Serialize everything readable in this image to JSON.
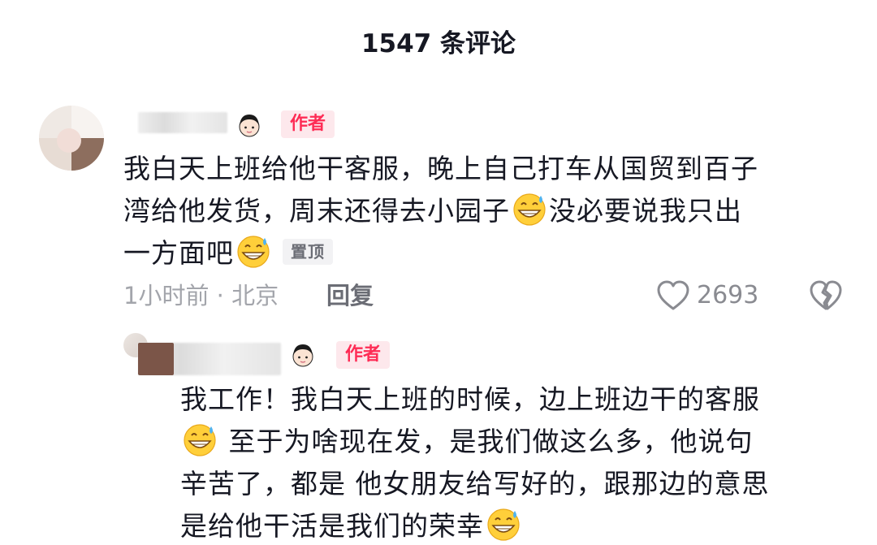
{
  "header": {
    "title": "1547 条评论"
  },
  "comment": {
    "author_badge": "作者",
    "line1": "我白天上班给他干客服，晚上自己打车从国贸到百子",
    "line2a": "湾给他发货，周末还得去小园子",
    "line2b": "没必要说我只出",
    "line3a": "一方面吧",
    "pin_label": "置顶",
    "time_location": "1小时前 · 北京",
    "reply_label": "回复",
    "like_count": "2693"
  },
  "reply": {
    "author_badge": "作者",
    "line1": "我工作！我白天上班的时候，边上班边干的客服",
    "line2": "至于为啥现在发，是我们做这么多，他说句",
    "line3": "辛苦了，都是 他女朋友给写好的，跟那边的意思",
    "line4": "是给他干活是我们的荣幸"
  },
  "icons": {
    "girl": "girl-face-icon",
    "emoji": "grinning-sweat-emoji-icon",
    "like": "heart-outline-icon",
    "dislike": "broken-heart-icon"
  },
  "colors": {
    "badge_text": "#fe2c55",
    "badge_bg": "#fde8ec",
    "meta": "#a3a5ab"
  }
}
